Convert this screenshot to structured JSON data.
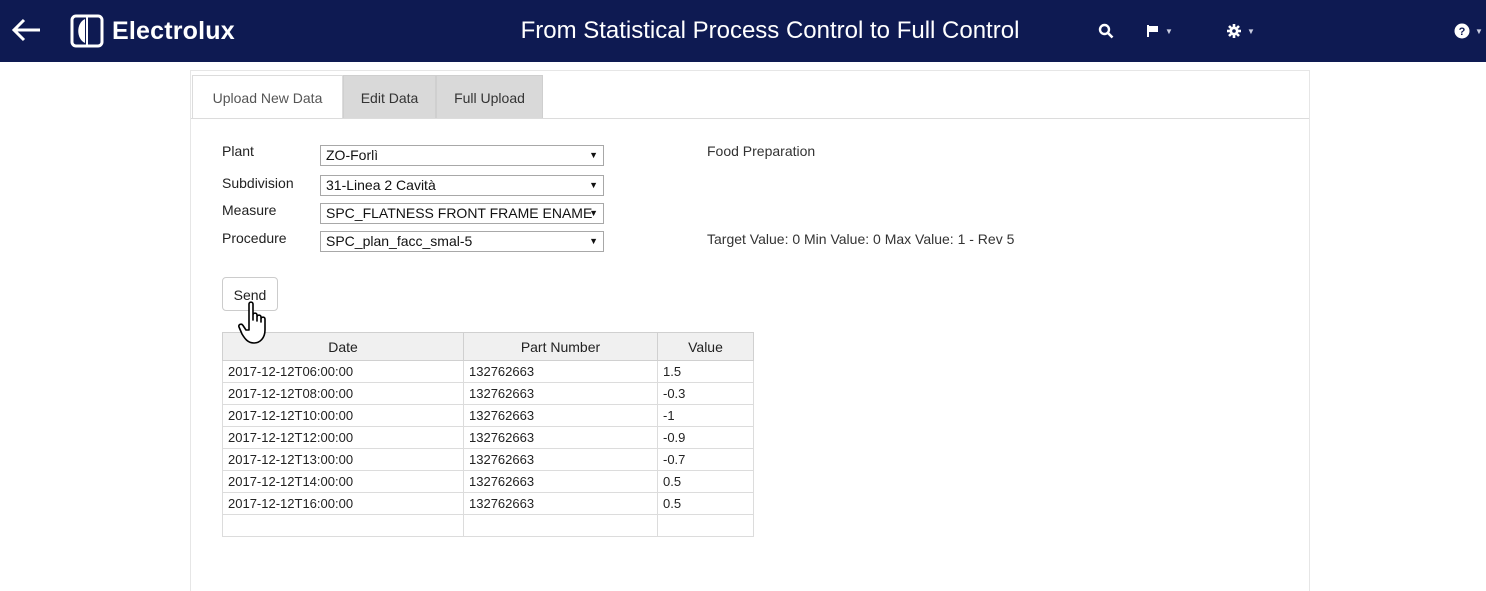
{
  "header": {
    "brand": "Electrolux",
    "title": "From Statistical Process Control to Full Control",
    "icons": [
      "back-arrow-icon",
      "search-icon",
      "flag-icon",
      "gear-icon",
      "help-icon"
    ]
  },
  "tabs": [
    {
      "label": "Upload New Data",
      "active": true
    },
    {
      "label": "Edit Data",
      "active": false
    },
    {
      "label": "Full Upload",
      "active": false
    }
  ],
  "form": {
    "plant": {
      "label": "Plant",
      "value": "ZO-Forlì"
    },
    "subdivision": {
      "label": "Subdivision",
      "value": "31-Linea 2 Cavità"
    },
    "measure": {
      "label": "Measure",
      "value": "SPC_FLATNESS FRONT FRAME ENAME"
    },
    "procedure": {
      "label": "Procedure",
      "value": "SPC_plan_facc_smal-5"
    },
    "division_text": "Food Preparation",
    "target_text": "Target Value: 0 Min Value: 0 Max Value: 1 - Rev 5",
    "send_label": "Send"
  },
  "table": {
    "columns": [
      "Date",
      "Part Number",
      "Value"
    ],
    "rows": [
      [
        "2017-12-12T06:00:00",
        "132762663",
        "1.5"
      ],
      [
        "2017-12-12T08:00:00",
        "132762663",
        "-0.3"
      ],
      [
        "2017-12-12T10:00:00",
        "132762663",
        "-1"
      ],
      [
        "2017-12-12T12:00:00",
        "132762663",
        "-0.9"
      ],
      [
        "2017-12-12T13:00:00",
        "132762663",
        "-0.7"
      ],
      [
        "2017-12-12T14:00:00",
        "132762663",
        "0.5"
      ],
      [
        "2017-12-12T16:00:00",
        "132762663",
        "0.5"
      ],
      [
        "",
        "",
        ""
      ]
    ]
  },
  "colors": {
    "navbar": "#0e1a52",
    "tab_inactive": "#d9d9d9",
    "table_header": "#f0f0f0"
  }
}
